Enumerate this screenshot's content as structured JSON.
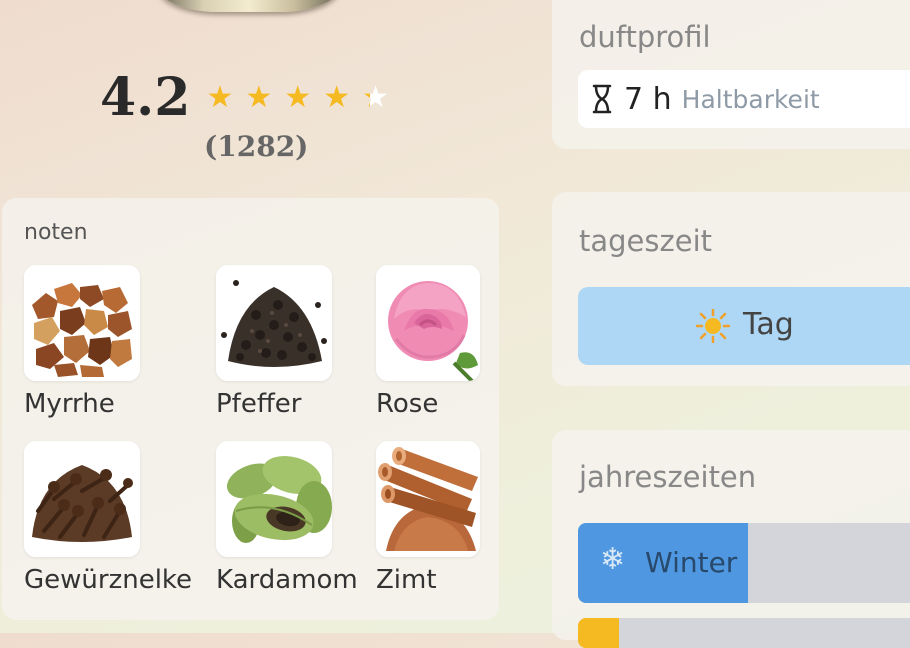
{
  "rating": {
    "value": "4.2",
    "count": "(1282)",
    "stars": 4.2,
    "star_glyph": "★",
    "star_color": "#f5b921"
  },
  "notes": {
    "title": "noten",
    "items": [
      {
        "label": "Myrrhe",
        "icon": "myrrh-resin-image"
      },
      {
        "label": "Pfeffer",
        "icon": "black-pepper-image"
      },
      {
        "label": "Rose",
        "icon": "rose-image"
      },
      {
        "label": "Gewürznelke",
        "icon": "clove-image"
      },
      {
        "label": "Kardamom",
        "icon": "cardamom-image"
      },
      {
        "label": "Zimt",
        "icon": "cinnamon-image"
      }
    ]
  },
  "duftprofil": {
    "title": "duftprofil",
    "longevity_value": "7 h",
    "longevity_label": "Haltbarkeit",
    "icon": "hourglass-icon"
  },
  "tageszeit": {
    "title": "tageszeit",
    "label": "Tag",
    "icon": "sun-icon",
    "color": "#aed7f5"
  },
  "jahreszeiten": {
    "title": "jahreszeiten",
    "seasons": [
      {
        "label": "Winter",
        "icon_glyph": "❄",
        "icon": "snowflake-icon",
        "fraction": 0.5,
        "color": "#4f98e1"
      },
      {
        "label": "",
        "icon_glyph": "",
        "icon": "",
        "fraction": 0.12,
        "color": "#f5b921"
      }
    ]
  }
}
